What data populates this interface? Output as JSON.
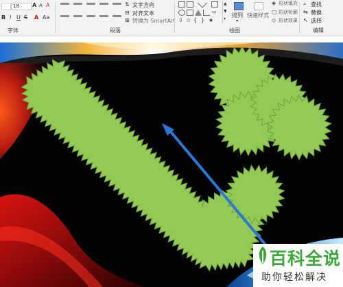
{
  "ribbon": {
    "font_size": "18",
    "groups": {
      "font_label": "字体",
      "paragraph_label": "段落",
      "drawing_label": "绘图",
      "editing_label": "编辑"
    },
    "paragraph": {
      "text_direction": "文字方向",
      "align_text": "对齐文本",
      "convert_smartart": "转换为 SmartArt"
    },
    "drawing": {
      "arrange": "排列",
      "quick_styles": "快速样式",
      "shape_fill": "形状填充",
      "shape_outline": "形状轮廓",
      "shape_effects": "形状效果"
    },
    "editing": {
      "find": "查找",
      "replace": "替换",
      "select": "选择"
    }
  },
  "watermark": {
    "title": "百科全说",
    "subtitle": "助你轻松解决"
  },
  "colors": {
    "shape_fill": "#95c957",
    "arrow": "#2a78d8",
    "watermark_green": "#3aa83a"
  }
}
